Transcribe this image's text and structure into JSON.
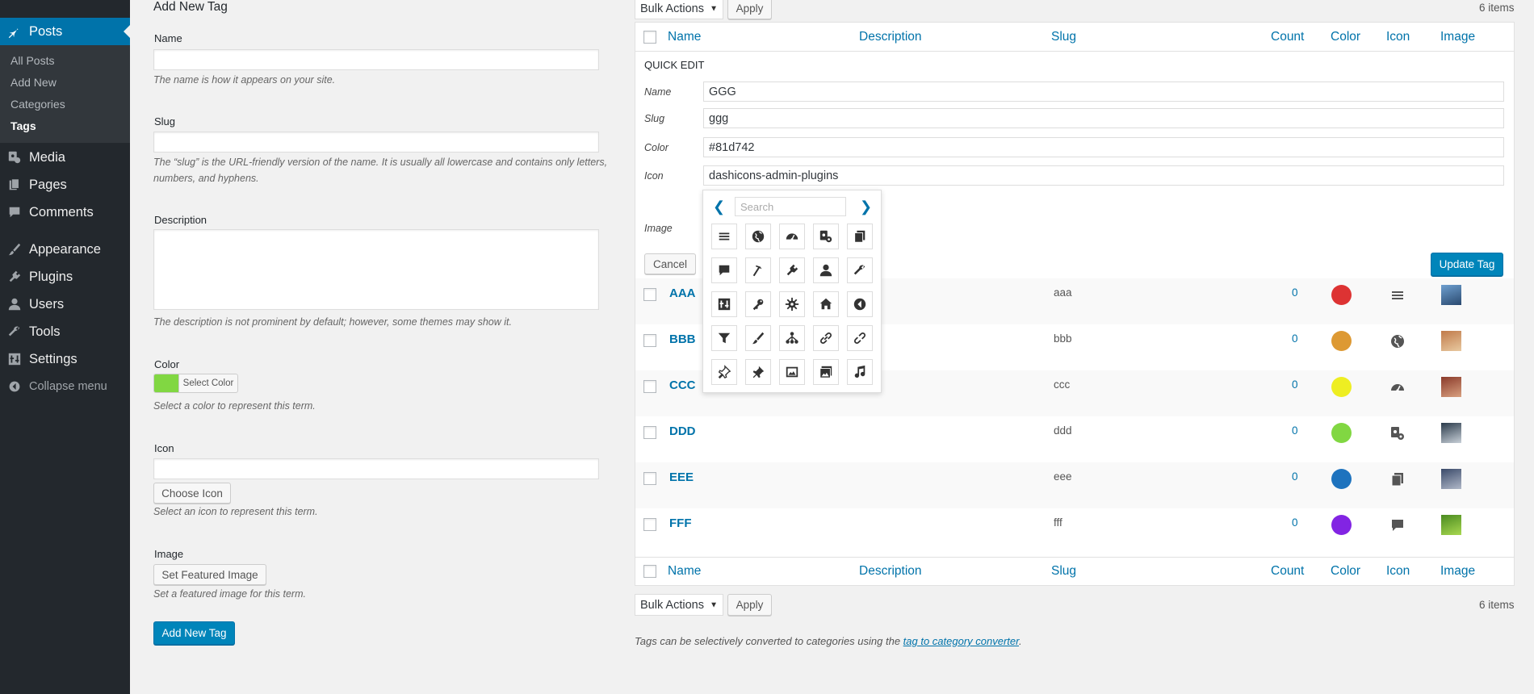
{
  "sidebar": {
    "menu": [
      {
        "label": "Posts",
        "icon": "pushpin-icon"
      },
      {
        "label": "Media",
        "icon": "media-icon"
      },
      {
        "label": "Pages",
        "icon": "pages-icon"
      },
      {
        "label": "Comments",
        "icon": "comment-icon"
      },
      {
        "label": "Appearance",
        "icon": "brush-icon"
      },
      {
        "label": "Plugins",
        "icon": "plugin-icon"
      },
      {
        "label": "Users",
        "icon": "user-icon"
      },
      {
        "label": "Tools",
        "icon": "wrench-icon"
      },
      {
        "label": "Settings",
        "icon": "settings-icon"
      }
    ],
    "submenu": [
      "All Posts",
      "Add New",
      "Categories",
      "Tags"
    ],
    "collapse": "Collapse menu"
  },
  "form": {
    "heading": "Add New Tag",
    "name_label": "Name",
    "name_help": "The name is how it appears on your site.",
    "slug_label": "Slug",
    "slug_help_1": "The “slug” is the URL-friendly version of the name. It is usually all lowercase and contains only letters,",
    "slug_help_2": "numbers, and hyphens.",
    "desc_label": "Description",
    "desc_help": "The description is not prominent by default; however, some themes may show it.",
    "color_label": "Color",
    "color_value": "#81d742",
    "select_color": "Select Color",
    "color_help": "Select a color to represent this term.",
    "icon_label": "Icon",
    "choose_icon": "Choose Icon",
    "icon_help": "Select an icon to represent this term.",
    "image_label": "Image",
    "set_image": "Set Featured Image",
    "image_help": "Set a featured image for this term.",
    "submit": "Add New Tag"
  },
  "list": {
    "bulk_actions": "Bulk Actions",
    "apply": "Apply",
    "items_count": "6 items",
    "columns": {
      "name": "Name",
      "description": "Description",
      "slug": "Slug",
      "count": "Count",
      "color": "Color",
      "icon": "Icon",
      "image": "Image"
    },
    "rows": [
      {
        "name": "AAA",
        "slug": "aaa",
        "count": "0",
        "color": "#dd3333",
        "icon": "menu-icon",
        "image": [
          "#6fa0d0",
          "#2a4a70"
        ]
      },
      {
        "name": "BBB",
        "slug": "bbb",
        "count": "0",
        "color": "#dd9933",
        "icon": "globe-icon",
        "image": [
          "#c07a4a",
          "#e8c9a0"
        ]
      },
      {
        "name": "CCC",
        "slug": "ccc",
        "count": "0",
        "color": "#eeee22",
        "icon": "dashboard-icon",
        "image": [
          "#8a3a2a",
          "#d8a080"
        ]
      },
      {
        "name": "DDD",
        "slug": "ddd",
        "count": "0",
        "color": "#81d742",
        "icon": "media-icon",
        "image": [
          "#2a3a4a",
          "#c8d0d8"
        ]
      },
      {
        "name": "EEE",
        "slug": "eee",
        "count": "0",
        "color": "#1e73be",
        "icon": "copy-icon",
        "image": [
          "#3a4a6a",
          "#b0b8c8"
        ]
      },
      {
        "name": "FFF",
        "slug": "fff",
        "count": "0",
        "color": "#8224e3",
        "icon": "comment-icon",
        "image": [
          "#4a8a20",
          "#a8d850"
        ]
      }
    ],
    "footer_note_prefix": "Tags can be selectively converted to categories using the ",
    "footer_note_link": "tag to category converter",
    "footer_note_suffix": "."
  },
  "quick_edit": {
    "title": "QUICK EDIT",
    "name_label": "Name",
    "name_value": "GGG",
    "slug_label": "Slug",
    "slug_value": "ggg",
    "color_label": "Color",
    "color_value": "#81d742",
    "icon_label": "Icon",
    "icon_value": "dashicons-admin-plugins",
    "image_label": "Image",
    "cancel": "Cancel",
    "update": "Update Tag"
  },
  "icon_picker": {
    "search_placeholder": "Search",
    "icons": [
      "menu-icon",
      "globe-icon",
      "dashboard-icon",
      "media-icon",
      "copy-icon",
      "comment-icon",
      "hammer-icon",
      "plugin-icon",
      "user-icon",
      "wrench-icon",
      "settings-grid-icon",
      "key-icon",
      "gear-icon",
      "home-icon",
      "arrow-left-circle-icon",
      "filter-icon",
      "brush-icon",
      "network-icon",
      "link-icon",
      "broken-link-icon",
      "pushpin-icon",
      "pushpin-filled-icon",
      "image-icon",
      "gallery-icon",
      "music-icon"
    ]
  }
}
